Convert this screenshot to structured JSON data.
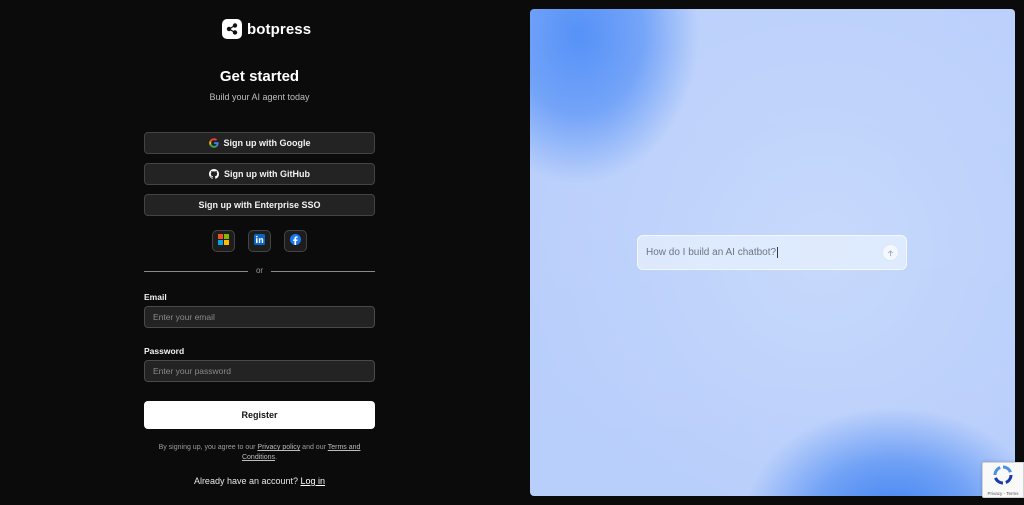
{
  "brand": {
    "name": "botpress"
  },
  "header": {
    "title": "Get started",
    "subtitle": "Build your AI agent today"
  },
  "oauth": {
    "google_label": "Sign up with Google",
    "github_label": "Sign up with GitHub",
    "sso_label": "Sign up with Enterprise SSO"
  },
  "social": [
    "microsoft-icon",
    "linkedin-icon",
    "facebook-icon"
  ],
  "divider_text": "or",
  "form": {
    "email_label": "Email",
    "email_placeholder": "Enter your email",
    "password_label": "Password",
    "password_placeholder": "Enter your password",
    "register_label": "Register"
  },
  "terms": {
    "prefix": "By signing up, you agree to our",
    "privacy_link": "Privacy policy",
    "middle": "and our",
    "terms_link": "Terms and Conditions",
    "suffix": "."
  },
  "login": {
    "prompt": "Already have an account?",
    "link": "Log in"
  },
  "hero": {
    "prompt_text": "How do I build an AI chatbot?"
  },
  "recaptcha": {
    "links": "Privacy - Terms"
  },
  "colors": {
    "background": "#0b0b0b",
    "button_surface": "#232323",
    "hero_blue": "#4d8cf7"
  }
}
